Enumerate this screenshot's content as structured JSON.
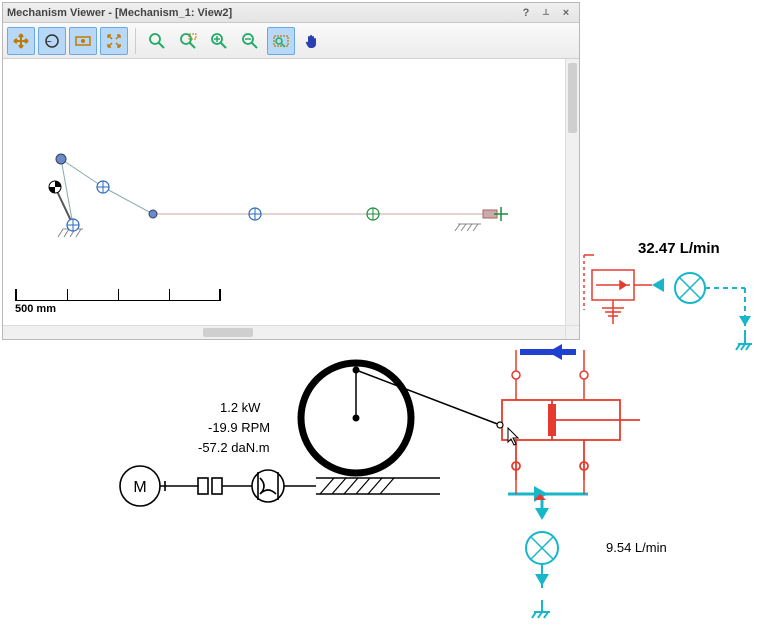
{
  "window": {
    "title": "Mechanism Viewer - [Mechanism_1: View2]",
    "help_glyph": "?",
    "pin_glyph": "⇩",
    "close_glyph": "×"
  },
  "toolbar": {
    "groups": [
      [
        "move-plus",
        "target",
        "eye-frame",
        "expand"
      ],
      [
        "zoom-magnifier",
        "zoom-region",
        "zoom-in",
        "zoom-out",
        "zoom-window",
        "pan-hand"
      ]
    ]
  },
  "scale": {
    "label": "500 mm"
  },
  "readouts": {
    "power": "1.2 kW",
    "speed": "-19.9 RPM",
    "torque": "-57.2 daN.m",
    "flow_upper": "32.47 L/min",
    "flow_lower": "9.54 L/min"
  },
  "colors": {
    "hyd_red": "#e63a2e",
    "hyd_teal": "#17b6c9",
    "hyd_blue": "#2040d0",
    "mech_black": "#000000"
  }
}
